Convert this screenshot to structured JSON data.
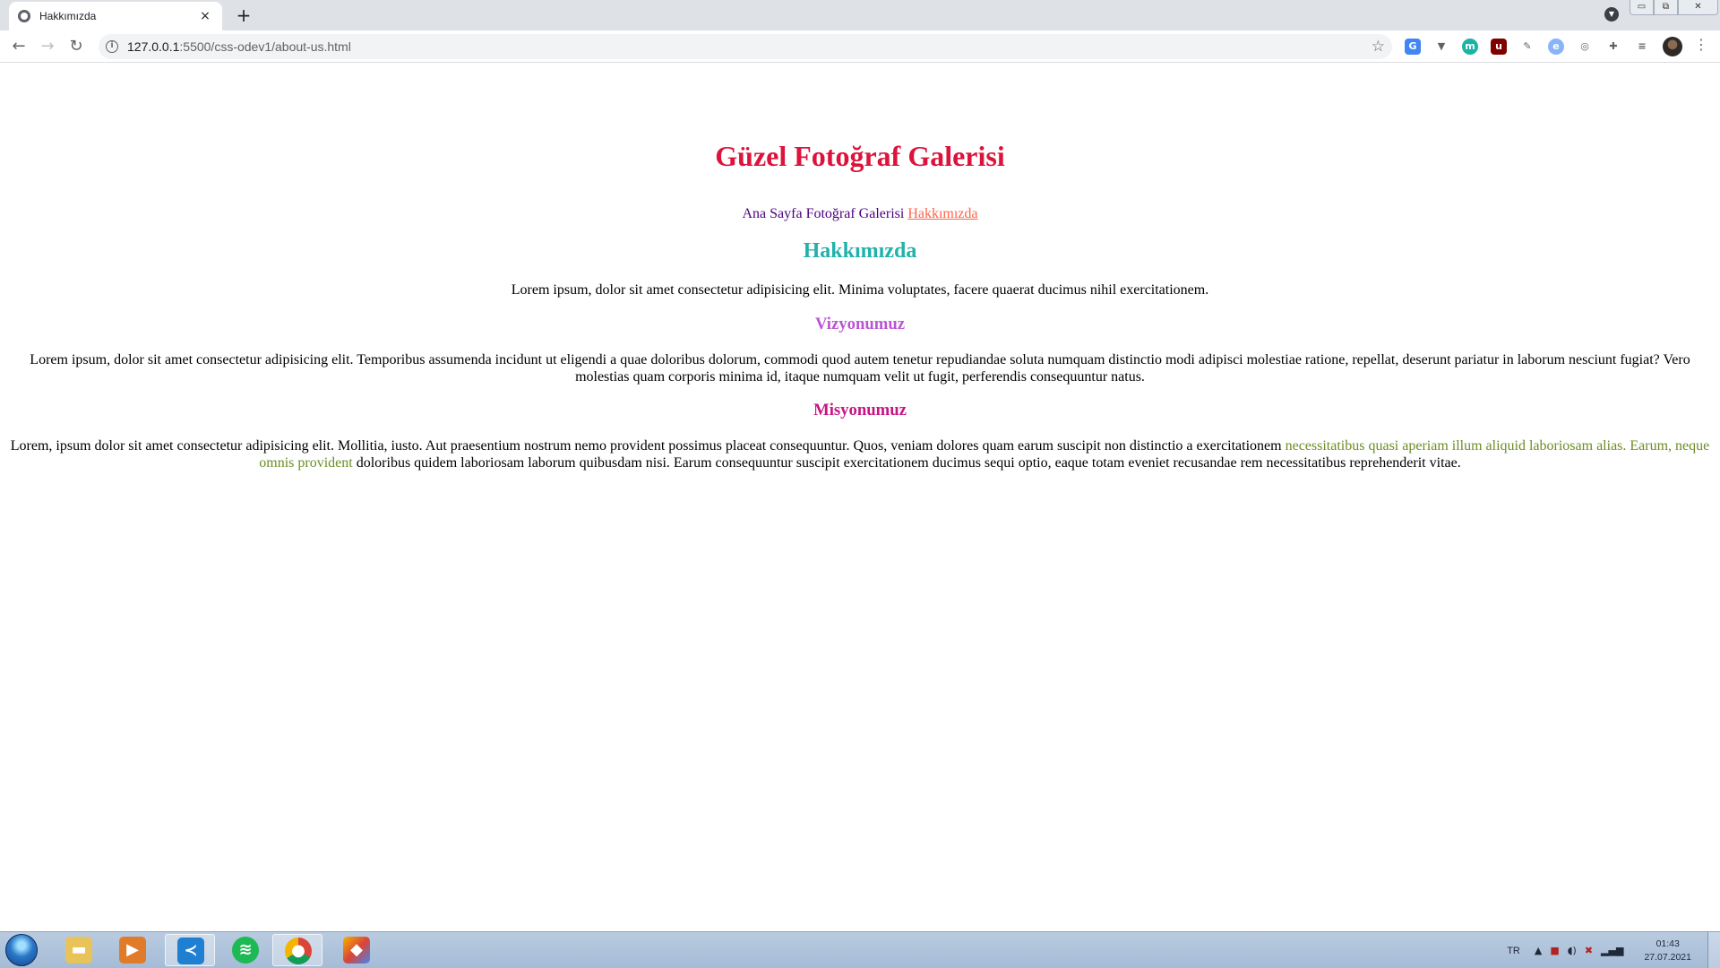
{
  "browser": {
    "tab_title": "Hakkımızda",
    "tab_close": "×",
    "new_tab": "+",
    "url_host": "127.0.0.1",
    "url_path": ":5500/css-odev1/about-us.html",
    "window_controls": [
      "▭",
      "⧉",
      "✕"
    ]
  },
  "page": {
    "site_title": "Güzel Fotoğraf Galerisi",
    "nav": {
      "home": "Ana Sayfa",
      "gallery": "Fotoğraf Galerisi",
      "about": "Hakkımızda"
    },
    "about_heading": "Hakkımızda",
    "about_text": "Lorem ipsum, dolor sit amet consectetur adipisicing elit. Minima voluptates, facere quaerat ducimus nihil exercitationem.",
    "vision_heading": "Vizyonumuz",
    "vision_text": "Lorem ipsum, dolor sit amet consectetur adipisicing elit. Temporibus assumenda incidunt ut eligendi a quae doloribus dolorum, commodi quod autem tenetur repudiandae soluta numquam distinctio modi adipisci molestiae ratione, repellat, deserunt pariatur in laborum nesciunt fugiat? Vero molestias quam corporis minima id, itaque numquam velit ut fugit, perferendis consequuntur natus.",
    "mission_heading": "Misyonumuz",
    "mission_text_1": "Lorem, ipsum dolor sit amet consectetur adipisicing elit. Mollitia, iusto. Aut praesentium nostrum nemo provident possimus placeat consequuntur. Quos, veniam dolores quam earum suscipit non distinctio a exercitationem ",
    "mission_text_highlight": "necessitatibus quasi aperiam illum aliquid laboriosam alias. Earum, neque omnis provident",
    "mission_text_2": " doloribus quidem laboriosam laborum quibusdam nisi. Earum consequuntur suscipit exercitationem ducimus sequi optio, eaque totam eveniet recusandae rem necessitatibus reprehenderit vitae."
  },
  "taskbar": {
    "language": "TR",
    "time": "01:43",
    "date": "27.07.2021"
  },
  "colors": {
    "site_title": "#dc143c",
    "nav_text": "#4b0082",
    "nav_active_link": "#ff6347",
    "about_heading": "#20b2aa",
    "vision_heading": "#ba55d3",
    "mission_heading": "#c71585",
    "mission_highlight": "#6b8e23"
  }
}
